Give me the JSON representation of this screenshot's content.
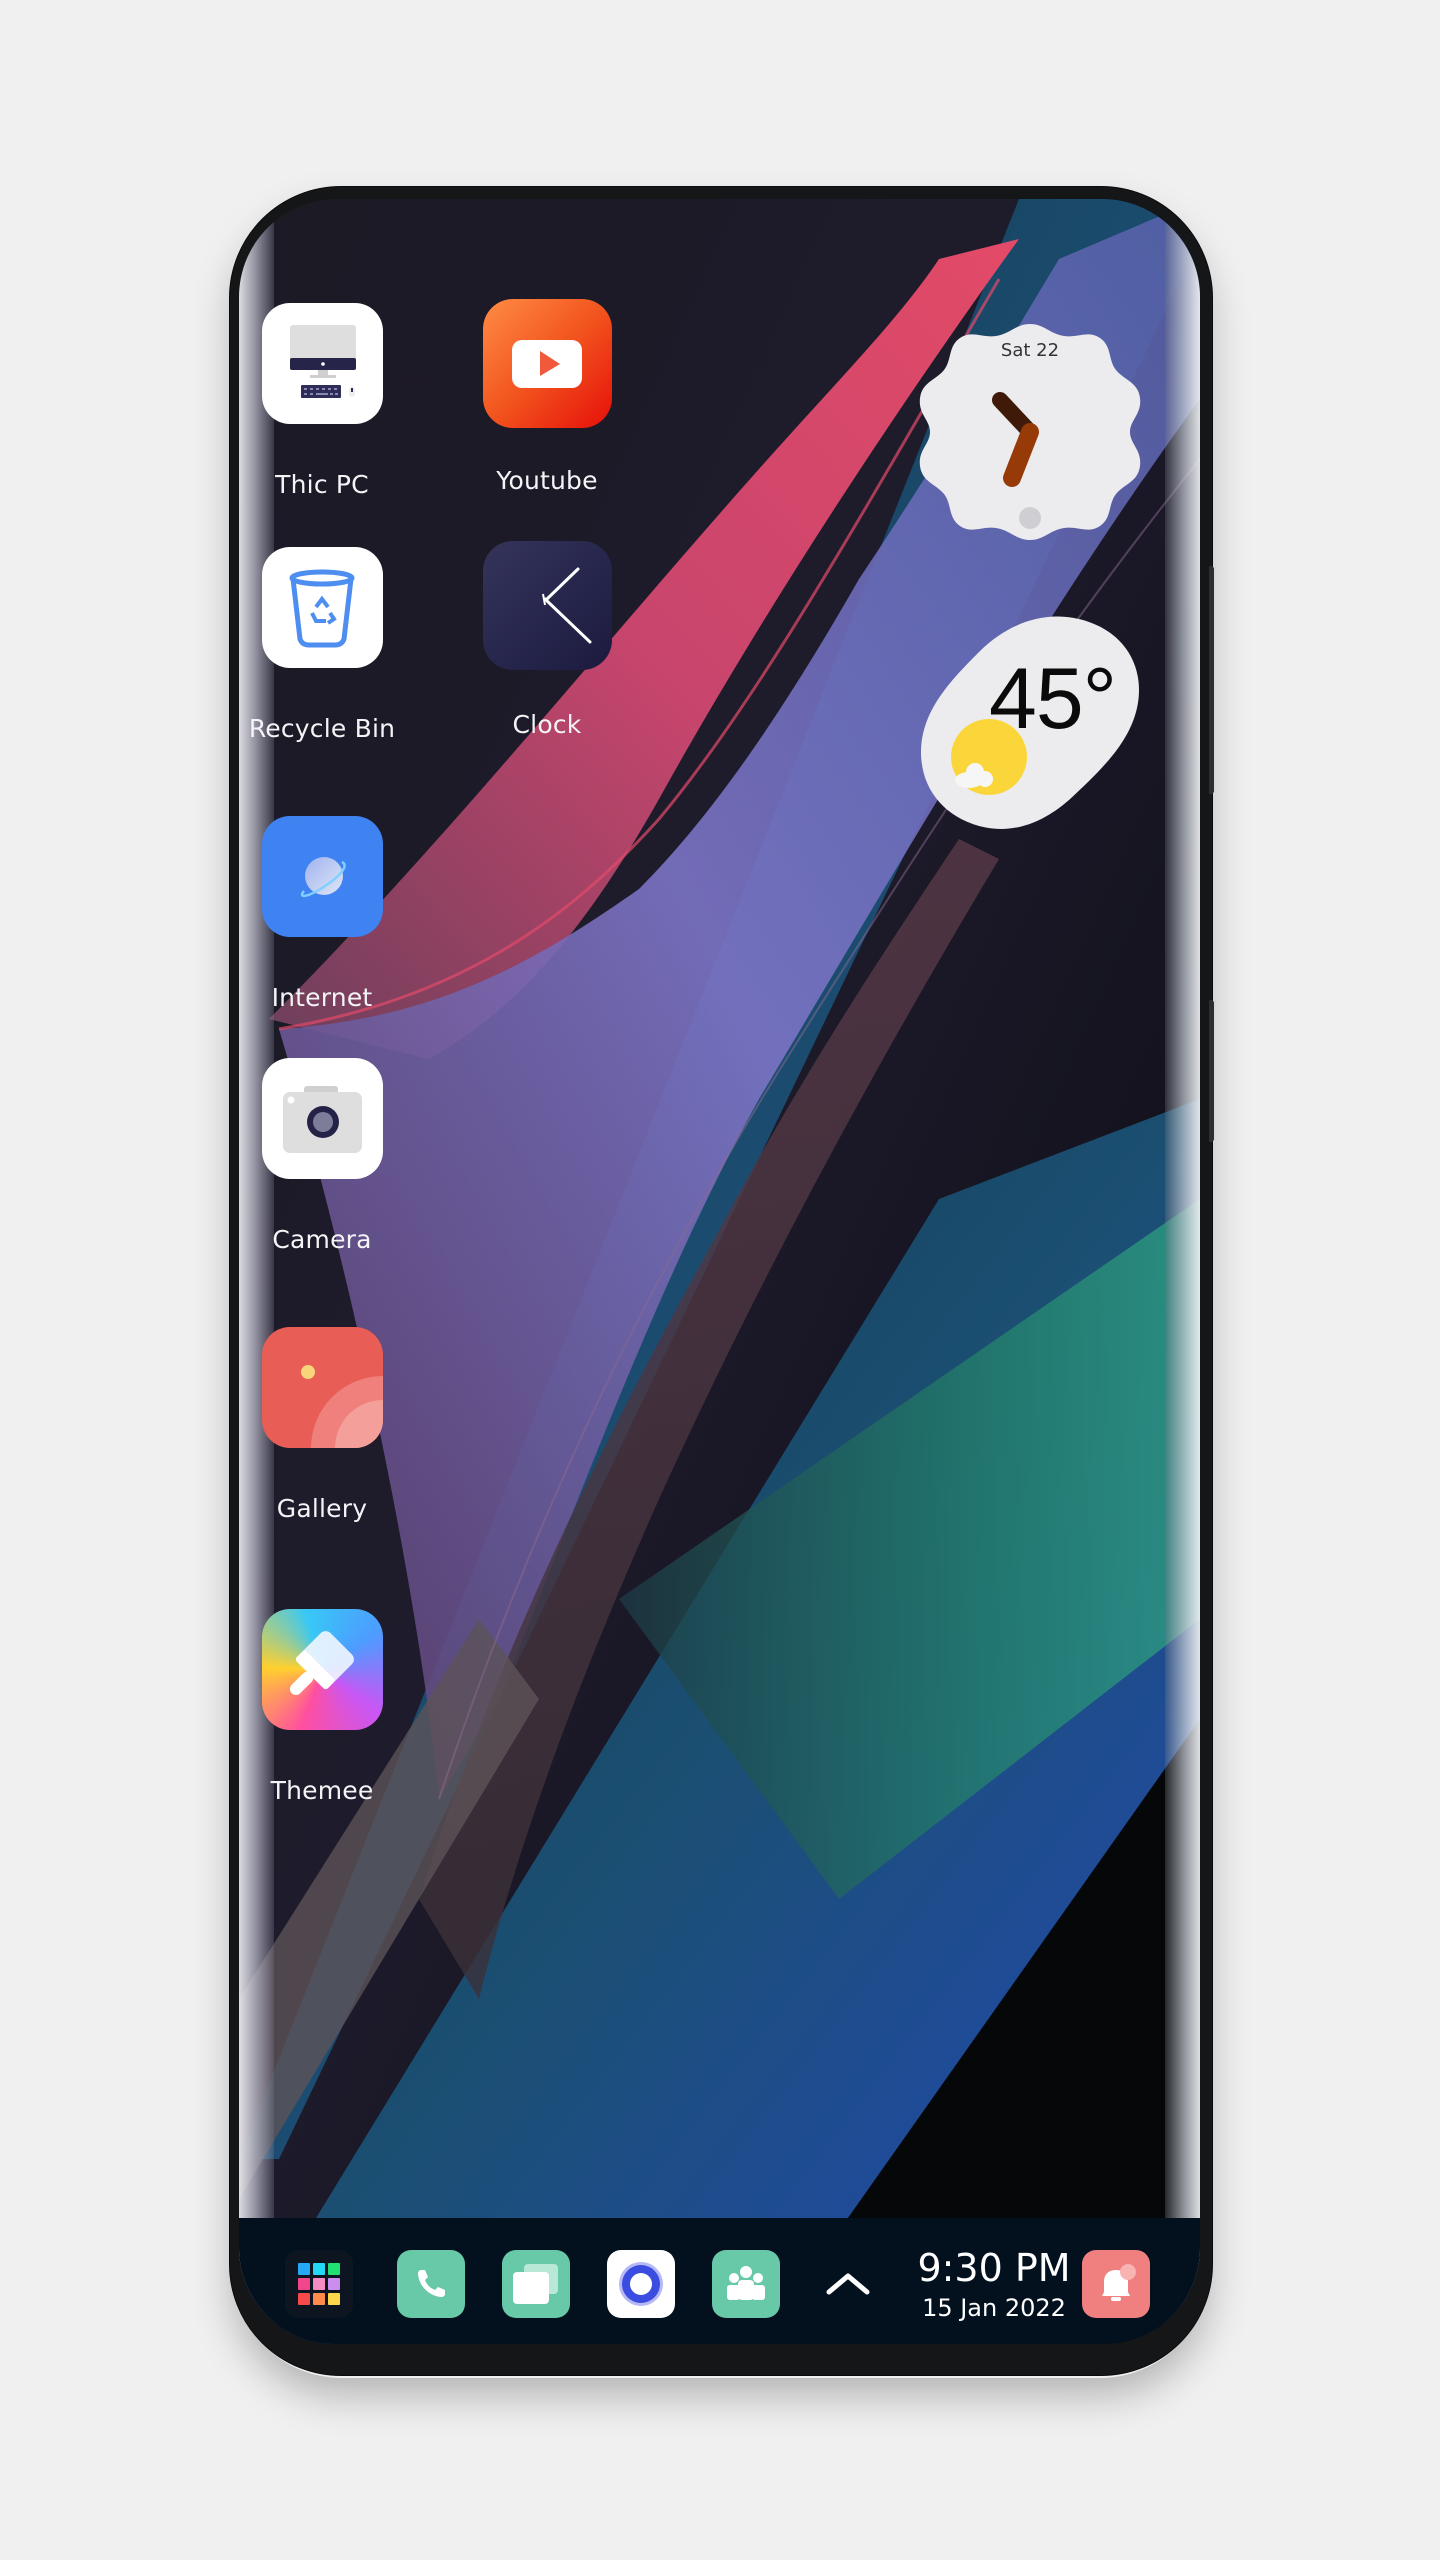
{
  "home_screen": {
    "apps": [
      {
        "id": "thic-pc",
        "label": "Thic PC",
        "icon": "computer-icon"
      },
      {
        "id": "youtube",
        "label": "Youtube",
        "icon": "youtube-icon"
      },
      {
        "id": "recycle-bin",
        "label": "Recycle Bin",
        "icon": "recycle-bin-icon"
      },
      {
        "id": "clock",
        "label": "Clock",
        "icon": "clock-icon"
      },
      {
        "id": "internet",
        "label": "Internet",
        "icon": "planet-icon"
      },
      {
        "id": "camera",
        "label": "Camera",
        "icon": "camera-icon"
      },
      {
        "id": "gallery",
        "label": "Gallery",
        "icon": "gallery-icon"
      },
      {
        "id": "themee",
        "label": "Themee",
        "icon": "paintbrush-icon"
      }
    ]
  },
  "widgets": {
    "clock": {
      "date": "Sat 22",
      "time_hour": 10,
      "time_minute": 35
    },
    "weather": {
      "temperature": "45°",
      "condition": "sunny-partly-cloudy"
    }
  },
  "taskbar": {
    "items": [
      {
        "id": "app-drawer",
        "icon": "app-grid-icon"
      },
      {
        "id": "phone",
        "icon": "phone-icon"
      },
      {
        "id": "multitask",
        "icon": "windows-icon"
      },
      {
        "id": "home",
        "icon": "circle-icon"
      },
      {
        "id": "contacts",
        "icon": "people-icon"
      }
    ],
    "expand_icon": "chevron-up-icon",
    "time": "9:30 PM",
    "date": "15 Jan 2022",
    "notification_icon": "bell-icon"
  },
  "colors": {
    "taskbar_bg": "#03111f",
    "dock_green": "#67c9a8",
    "notification_red": "#f07f7f",
    "youtube_red": "#f0401c",
    "internet_blue": "#3f82f2",
    "clock_bg": "#2d2c4e",
    "gallery_red": "#e85d55"
  }
}
